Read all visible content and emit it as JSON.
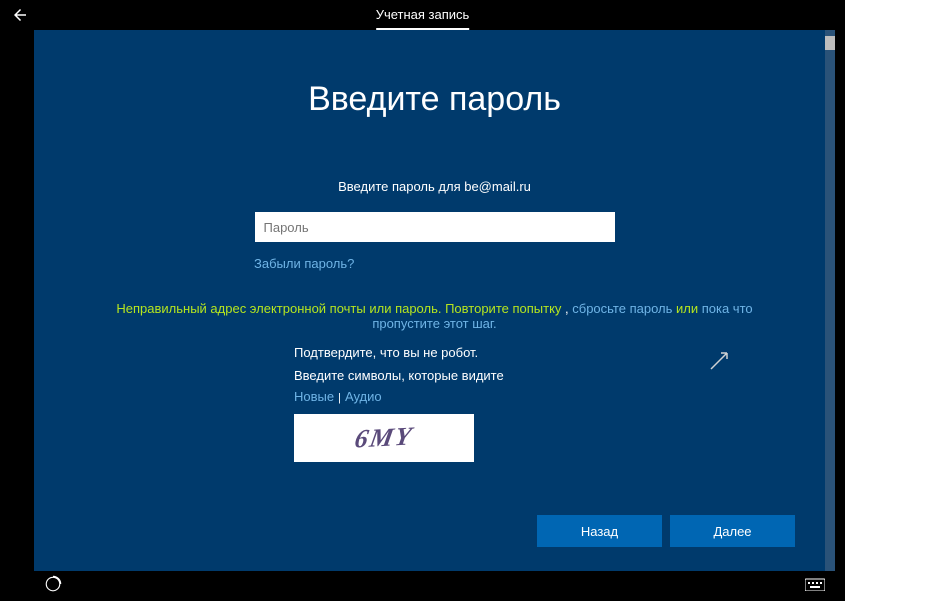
{
  "header": {
    "tab_label": "Учетная запись"
  },
  "page": {
    "title": "Введите пароль",
    "prompt_prefix": "Введите пароль для ",
    "email": "be@mail.ru",
    "password_placeholder": "Пароль",
    "forgot_link": "Забыли пароль?"
  },
  "error": {
    "msg_main": "Неправильный адрес электронной почты или пароль. Повторите попытку",
    "sep1": " , ",
    "reset_link": "сбросьте пароль",
    "sep2": " или ",
    "skip_link": "пока что пропустите этот шаг.",
    "sep_or": " или "
  },
  "captcha": {
    "confirm_text": "Подтвердите, что вы не робот.",
    "enter_chars": "Введите символы, которые видите",
    "new_link": "Новые",
    "audio_link": "Аудио",
    "image_text": "6MY"
  },
  "buttons": {
    "back": "Назад",
    "next": "Далее"
  }
}
